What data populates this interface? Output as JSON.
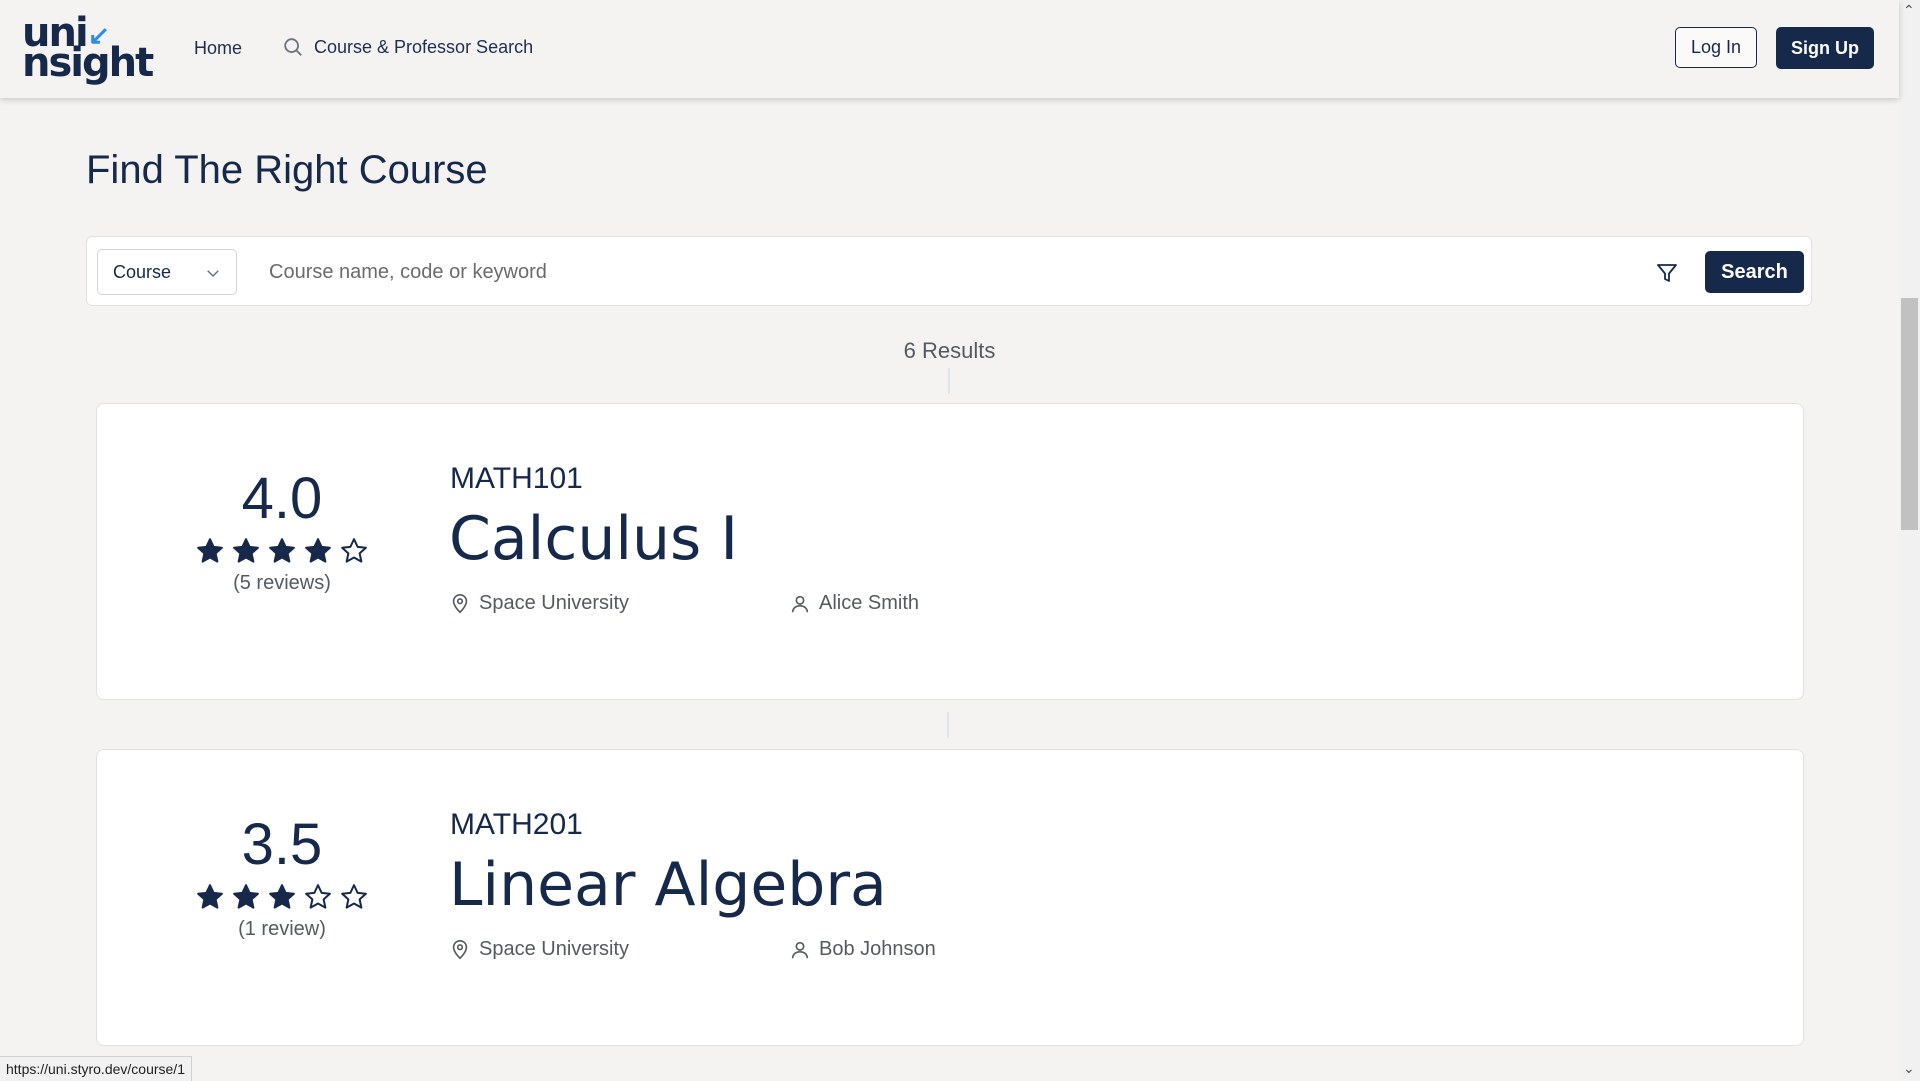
{
  "nav": {
    "logo_top": "uni",
    "logo_bottom": "nsight",
    "home": "Home",
    "search_link": "Course & Professor Search",
    "login": "Log In",
    "signup": "Sign Up"
  },
  "page": {
    "title": "Find The Right Course"
  },
  "search": {
    "type_selected": "Course",
    "placeholder": "Course name, code or keyword",
    "button": "Search"
  },
  "results": {
    "count_label": "6 Results",
    "courses": [
      {
        "rating": "4.0",
        "stars_filled": 4,
        "reviews": "(5 reviews)",
        "code": "MATH101",
        "name": "Calculus I",
        "university": "Space University",
        "professor": "Alice Smith"
      },
      {
        "rating": "3.5",
        "stars_filled": 3,
        "reviews": "(1 review)",
        "code": "MATH201",
        "name": "Linear Algebra",
        "university": "Space University",
        "professor": "Bob Johnson"
      }
    ]
  },
  "status_bar": {
    "url": "https://uni.styro.dev/course/1"
  },
  "colors": {
    "brand_navy": "#16294a",
    "brand_blue": "#2d8fe3",
    "background": "#f4f3f2"
  }
}
